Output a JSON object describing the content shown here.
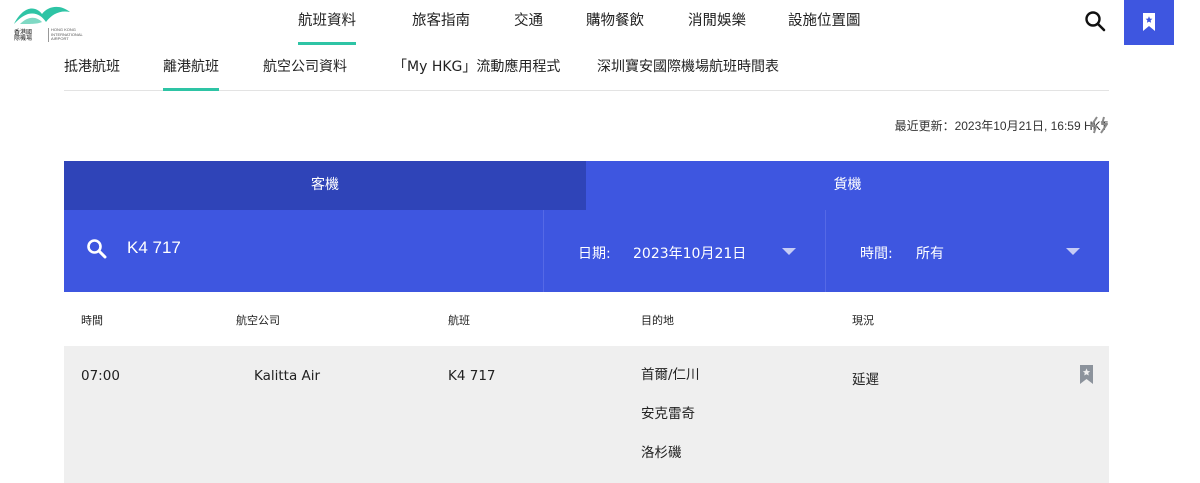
{
  "logo": {
    "text_tc": "香港國際機場",
    "text_en": "HONG KONG INTERNATIONAL AIRPORT",
    "color": "#2ec4a5"
  },
  "main_nav": [
    {
      "label": "航班資料",
      "active": true
    },
    {
      "label": "旅客指南",
      "active": false
    },
    {
      "label": "交通",
      "active": false
    },
    {
      "label": "購物餐飲",
      "active": false
    },
    {
      "label": "消閒娛樂",
      "active": false
    },
    {
      "label": "設施位置圖",
      "active": false
    }
  ],
  "sub_nav": [
    {
      "label": "抵港航班",
      "active": false
    },
    {
      "label": "離港航班",
      "active": true
    },
    {
      "label": "航空公司資料",
      "active": false
    },
    {
      "label": "「My HKG」流動應用程式",
      "active": false
    },
    {
      "label": "深圳寶安國際機場航班時間表",
      "active": false
    }
  ],
  "last_updated": "最近更新：2023年10月21日, 16:59 HKT",
  "tabs": {
    "passenger": "客機",
    "cargo": "貨機",
    "active": "cargo"
  },
  "filters": {
    "search_value": "K4 717",
    "date_label": "日期:",
    "date_value": "2023年10月21日",
    "time_label": "時間:",
    "time_value": "所有"
  },
  "table": {
    "headers": [
      "時間",
      "航空公司",
      "航班",
      "目的地",
      "現況"
    ],
    "rows": [
      {
        "time": "07:00",
        "airline": "Kalitta Air",
        "flight": "K4 717",
        "destinations": [
          "首爾/仁川",
          "安克雷奇",
          "洛杉磯"
        ],
        "status": "延遲"
      }
    ]
  },
  "colors": {
    "accent_teal": "#2ec4a5",
    "primary_blue": "#3e56e0",
    "dark_blue": "#2f44b8",
    "row_bg": "#efefef"
  }
}
